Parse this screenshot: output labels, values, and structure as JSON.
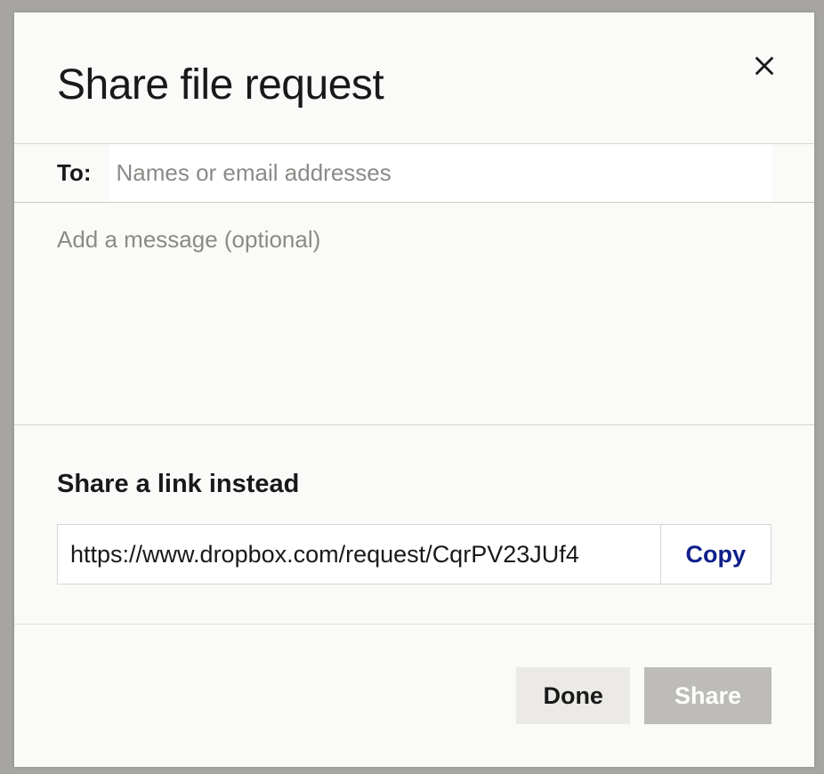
{
  "modal": {
    "title": "Share file request",
    "to_label": "To:",
    "to_placeholder": "Names or email addresses",
    "message_placeholder": "Add a message (optional)",
    "link_heading": "Share a link instead",
    "link_value": "https://www.dropbox.com/request/CqrPV23JUf4",
    "copy_label": "Copy",
    "done_label": "Done",
    "share_label": "Share"
  }
}
